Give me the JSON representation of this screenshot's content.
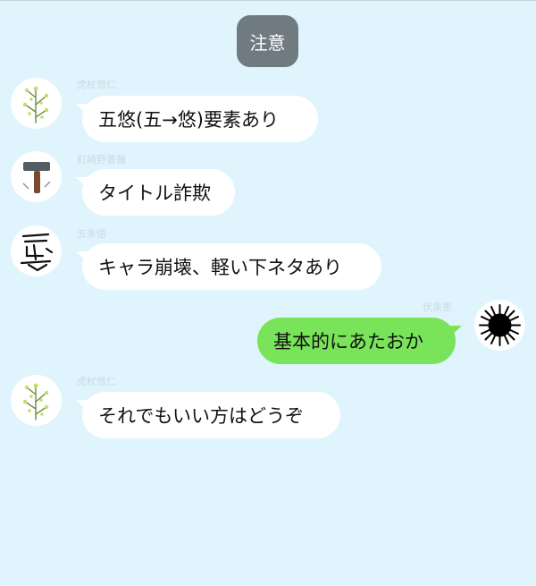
{
  "notice": "注意",
  "messages": [
    {
      "sender": "虎杖悠仁",
      "text": "五悠(五→悠)要素あり",
      "side": "left",
      "avatar": "plant-icon"
    },
    {
      "sender": "釘崎野薔薇",
      "text": "タイトル詐欺",
      "side": "left",
      "avatar": "hammer-icon"
    },
    {
      "sender": "五条悟",
      "text": "キャラ崩壊、軽い下ネタあり",
      "side": "left",
      "avatar": "calligraphy-icon"
    },
    {
      "sender": "伏黒恵",
      "text": "基本的にあたおか",
      "side": "right",
      "avatar": "urchin-icon"
    },
    {
      "sender": "虎杖悠仁",
      "text": "それでもいい方はどうぞ",
      "side": "left",
      "avatar": "plant-icon"
    }
  ],
  "colors": {
    "background": "#dff4fd",
    "notice": "#6f7b80",
    "own_bubble": "#79e45a",
    "other_bubble": "#ffffff"
  }
}
